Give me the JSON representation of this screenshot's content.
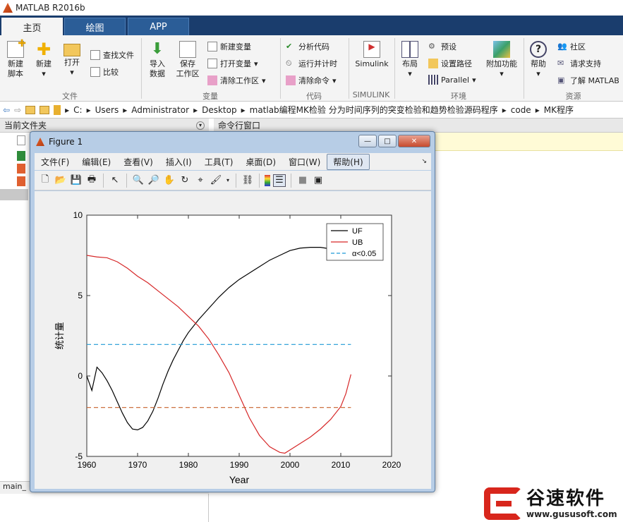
{
  "app": {
    "title": "MATLAB R2016b"
  },
  "tabs": [
    {
      "label": "主页"
    },
    {
      "label": "绘图"
    },
    {
      "label": "APP"
    }
  ],
  "ribbon": {
    "file": {
      "new_script": "新建\n脚本",
      "new": "新建",
      "open": "打开",
      "find_files": "查找文件",
      "compare": "比较",
      "group": "文件"
    },
    "variable": {
      "import": "导入\n数据",
      "save": "保存\n工作区",
      "new_var": "新建变量",
      "open_var": "打开变量",
      "clear_ws": "清除工作区",
      "group": "变量"
    },
    "code": {
      "analyze": "分析代码",
      "run_time": "运行并计时",
      "clear_cmd": "清除命令",
      "group": "代码"
    },
    "simulink": {
      "label": "Simulink",
      "group": "SIMULINK"
    },
    "env": {
      "layout": "布局",
      "prefs": "预设",
      "set_path": "设置路径",
      "parallel": "Parallel",
      "addons": "附加功能",
      "group": "环境"
    },
    "res": {
      "help": "帮助",
      "community": "社区",
      "support": "请求支持",
      "learn": "了解 MATLAB",
      "group": "资源"
    }
  },
  "address": {
    "parts": [
      "C:",
      "Users",
      "Administrator",
      "Desktop",
      "matlab编程MK检验 分为时间序列的突变检验和趋势检验源码程序",
      "code",
      "MK程序"
    ]
  },
  "panels": {
    "current_folder": "当前文件夹",
    "command_window": "命令行窗口",
    "main_tab": "main_"
  },
  "figure": {
    "title": "Figure 1",
    "menus": [
      "文件(F)",
      "编辑(E)",
      "查看(V)",
      "插入(I)",
      "工具(T)",
      "桌面(D)",
      "窗口(W)",
      "帮助(H)"
    ],
    "buttons": {
      "minimize": "—",
      "maximize": "□",
      "close": "✕"
    }
  },
  "chart_data": {
    "type": "line",
    "xlabel": "Year",
    "ylabel": "统计量",
    "xlim": [
      1960,
      2020
    ],
    "ylim": [
      -5,
      10
    ],
    "xticks": [
      1960,
      1970,
      1980,
      1990,
      2000,
      2010,
      2020
    ],
    "yticks": [
      -5,
      0,
      5,
      10
    ],
    "legend_position": "top-right",
    "series": [
      {
        "name": "UF",
        "color": "#000000",
        "style": "solid",
        "x": [
          1960,
          1961,
          1962,
          1963,
          1964,
          1965,
          1966,
          1967,
          1968,
          1969,
          1970,
          1971,
          1972,
          1973,
          1974,
          1975,
          1976,
          1977,
          1978,
          1979,
          1980,
          1982,
          1984,
          1986,
          1988,
          1990,
          1992,
          1994,
          1996,
          1998,
          2000,
          2002,
          2004,
          2006,
          2008,
          2010,
          2012
        ],
        "y": [
          0.0,
          -0.9,
          0.55,
          0.2,
          -0.3,
          -0.9,
          -1.6,
          -2.3,
          -2.9,
          -3.3,
          -3.35,
          -3.2,
          -2.8,
          -2.2,
          -1.4,
          -0.5,
          0.3,
          1.0,
          1.6,
          2.2,
          2.7,
          3.5,
          4.2,
          4.9,
          5.5,
          6.0,
          6.4,
          6.8,
          7.2,
          7.5,
          7.8,
          7.95,
          8.0,
          8.0,
          7.9,
          7.8,
          7.7
        ]
      },
      {
        "name": "UB",
        "color": "#d62728",
        "style": "solid",
        "x": [
          1960,
          1962,
          1964,
          1966,
          1968,
          1970,
          1972,
          1974,
          1976,
          1978,
          1980,
          1982,
          1984,
          1986,
          1988,
          1990,
          1992,
          1994,
          1996,
          1998,
          1999,
          2000,
          2002,
          2004,
          2006,
          2008,
          2010,
          2011,
          2012
        ],
        "y": [
          7.5,
          7.4,
          7.35,
          7.1,
          6.7,
          6.2,
          5.8,
          5.3,
          4.8,
          4.3,
          3.7,
          3.1,
          2.3,
          1.3,
          0.2,
          -1.2,
          -2.6,
          -3.7,
          -4.4,
          -4.75,
          -4.8,
          -4.6,
          -4.2,
          -3.8,
          -3.3,
          -2.7,
          -1.9,
          -1.1,
          0.1
        ]
      },
      {
        "name": "α<0.05",
        "color": "#1f9ad6",
        "style": "dashed",
        "x": [
          1960,
          2012
        ],
        "y": [
          1.96,
          1.96
        ]
      },
      {
        "name": "",
        "color": "#c8602a",
        "style": "dashed",
        "x": [
          1960,
          2012
        ],
        "y": [
          -1.96,
          -1.96
        ]
      }
    ]
  },
  "watermark": {
    "brand": "谷速软件",
    "url": "www.gususoft.com"
  }
}
